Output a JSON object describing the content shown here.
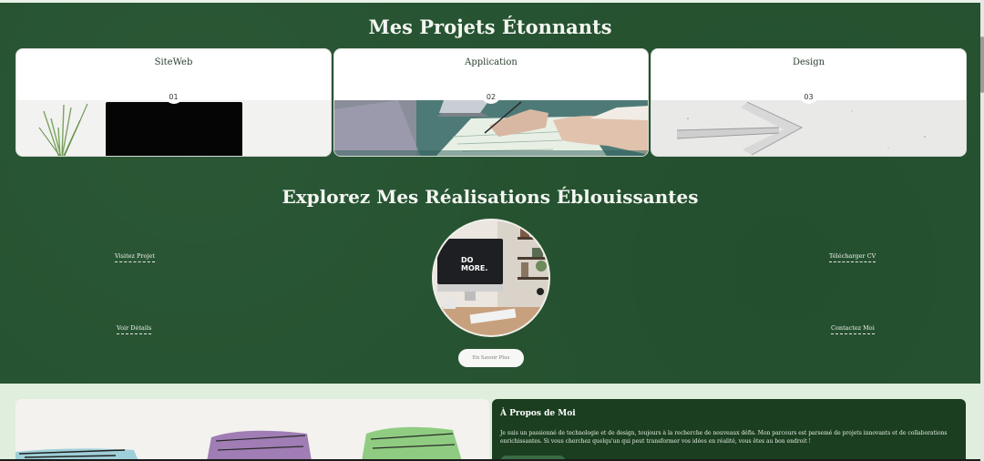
{
  "projects": {
    "title": "Mes Projets Étonnants",
    "cards": [
      {
        "title": "SiteWeb",
        "number": "01"
      },
      {
        "title": "Application",
        "number": "02"
      },
      {
        "title": "Design",
        "number": "03"
      }
    ]
  },
  "explore": {
    "title": "Explorez Mes Réalisations Éblouissantes",
    "links": {
      "visit": "Visitez Projet",
      "details": "Voir Détails",
      "cv": "Télécharger CV",
      "contact": "Contactez Moi"
    },
    "photo_text": "DO MORE.",
    "more_button": "En Savoir Plus"
  },
  "about": {
    "title": "À Propos de Moi",
    "text": "Je suis un passionné de technologie et de design, toujours à la recherche de nouveaux défis. Mon parcours est parsemé de projets innovants et de collaborations enrichissantes. Si vous cherchez quelqu'un qui peut transformer vos idées en réalité, vous êtes au bon endroit !"
  },
  "colors": {
    "section_green": "#265331",
    "about_green": "#1a3e1f",
    "page_bg": "#dfeedd"
  }
}
